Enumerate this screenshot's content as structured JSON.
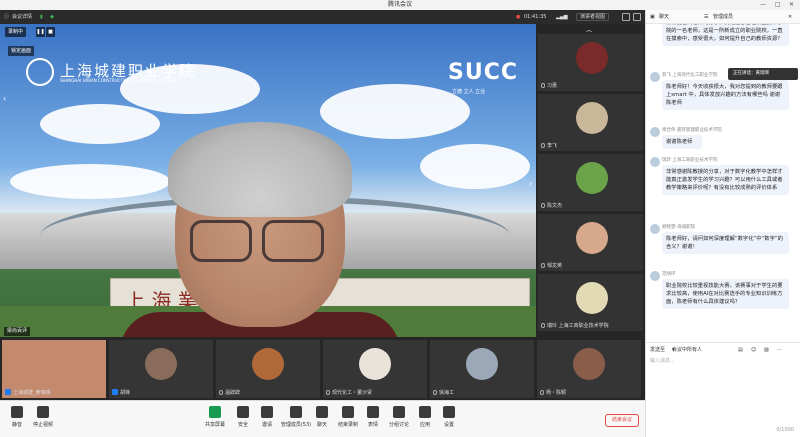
{
  "window": {
    "title": "腾讯会议",
    "controls": [
      "—",
      "□",
      "✕"
    ]
  },
  "infobar": {
    "meeting_info": "会议详情",
    "timer": "01:41:35",
    "share_screen": "演讲者视图",
    "view_mode": "全屏"
  },
  "main_video": {
    "recording": "录制中",
    "locked_speaker": "锁定画面",
    "speaker_name": "梁尚百评",
    "school_cn": "上海城建职业学院",
    "school_en": "SHANGHAI URBAN CONSTRUCTION VOCATIONAL COLLEGE",
    "brand": "SUCC",
    "motto": "立德  立人  立业",
    "sign_text": "上 海          業 學 院"
  },
  "right_tiles": [
    {
      "name": "习惠",
      "color": "#7a2a2a"
    },
    {
      "name": "李飞",
      "color": "#c9b79a"
    },
    {
      "name": "陈文杰",
      "color": "#6aa34a"
    },
    {
      "name": "邹龙英",
      "color": "#d7a98c"
    },
    {
      "name": "瑞玲 上海工商职业技术学院",
      "color": "#e2d9b5"
    }
  ],
  "bottom_tiles": [
    {
      "name": "上海城建_黄瑞瑛",
      "color": "#c48a6e"
    },
    {
      "name": "胡锋",
      "color": "#8a6c5c"
    },
    {
      "name": "温辟辟",
      "color": "#b06a3a"
    },
    {
      "name": "现代化工・董沙贤",
      "color": "#e8e2d8"
    },
    {
      "name": "徐海工",
      "color": "#9aa8b8"
    },
    {
      "name": "杨・陈颖",
      "color": "#8a5d4a"
    }
  ],
  "toolbar": {
    "items": [
      "静音",
      "停止视频",
      "共享屏幕",
      "安全",
      "邀请",
      "管理成员(53)",
      "聊天",
      "结束录制",
      "表情",
      "分组讨论",
      "应用",
      "设置"
    ],
    "leave": "结束会议"
  },
  "chat": {
    "title": "聊天",
    "tab": "管理成员",
    "tooltip": "正在讲话：黄瑞瑛",
    "messages": [
      {
        "sender": "",
        "text": "常常能看到老师的分享，我是信息管理职业技术学院的一名老师，这是一所新成立的职业院校，一直在摸索中，感受很大，如何提升自己的教师资源？"
      },
      {
        "sender": "羿飞  上海现代化工职业学院",
        "text": "陈老师好！今天收获很大，我对您提到的教师要跟上smart 中，具体发放兴趣的方法有哪些吗 谢谢陈老师"
      },
      {
        "sender": "章佳伟 嘉宾管理职业技术学院",
        "text": "谢谢陈老师"
      },
      {
        "sender": "瑞玲 上海工商职业技术学院",
        "text": "非常感谢陈教授的分享，对于数字化教学中怎样才能真正激发学生的学习兴趣？可以用什么工具或者教学策略来评价呢？有没有比较成熟的评价体系"
      },
      {
        "sender": "顾晓雯-海城职院",
        "text": "陈老师好，请问如何深度理解“数字化”中“数字”的含义？谢谢！"
      },
      {
        "sender": "范炳环",
        "text": "职业院校比较重视技能大赛，该赛事对于学生的要求比较高，使用AI在对比赛选手的专业知识训练方面，陈老师有什么具体建议吗？"
      }
    ],
    "send_to": "发送至",
    "recipient": "会议中所有人",
    "placeholder": "输入消息...",
    "word_count": "0/1000"
  }
}
